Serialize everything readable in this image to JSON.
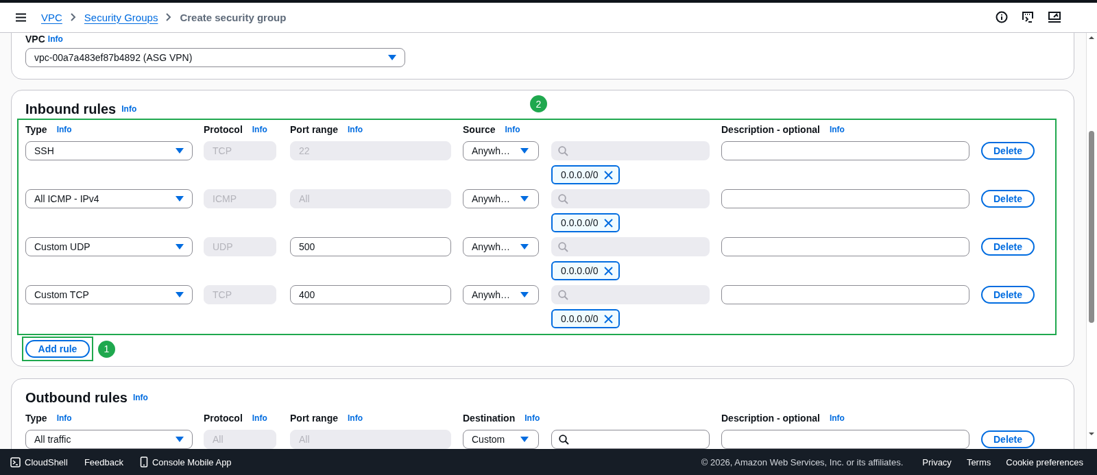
{
  "header": {
    "breadcrumbs": [
      {
        "label": "VPC",
        "link": true
      },
      {
        "label": "Security Groups",
        "link": true
      },
      {
        "label": "Create security group",
        "link": false
      }
    ]
  },
  "vpc": {
    "label": "VPC",
    "info": "Info",
    "value": "vpc-00a7a483ef87b4892 (ASG VPN)"
  },
  "inbound": {
    "title": "Inbound rules",
    "info": "Info",
    "highlighted": true,
    "badge": "2",
    "columns": [
      {
        "label": "Type",
        "info": "Info"
      },
      {
        "label": "Protocol",
        "info": "Info"
      },
      {
        "label": "Port range",
        "info": "Info"
      },
      {
        "label": "Source",
        "info": "Info"
      },
      {
        "label": "Description - optional",
        "info": "Info"
      }
    ],
    "rules": [
      {
        "type": "SSH",
        "protocol": "TCP",
        "port": "22",
        "port_disabled": true,
        "source": "Anywh…",
        "search_disabled": true,
        "chip": "0.0.0.0/0",
        "delete": "Delete"
      },
      {
        "type": "All ICMP - IPv4",
        "protocol": "ICMP",
        "port": "All",
        "port_disabled": true,
        "source": "Anywh…",
        "search_disabled": true,
        "chip": "0.0.0.0/0",
        "delete": "Delete"
      },
      {
        "type": "Custom UDP",
        "protocol": "UDP",
        "port": "500",
        "port_disabled": false,
        "source": "Anywh…",
        "search_disabled": true,
        "chip": "0.0.0.0/0",
        "delete": "Delete"
      },
      {
        "type": "Custom TCP",
        "protocol": "TCP",
        "port": "400",
        "port_disabled": false,
        "source": "Anywh…",
        "search_disabled": true,
        "chip": "0.0.0.0/0",
        "delete": "Delete"
      }
    ],
    "add_rule": {
      "label": "Add rule",
      "highlighted": true,
      "badge": "1"
    }
  },
  "outbound": {
    "title": "Outbound rules",
    "info": "Info",
    "highlighted": false,
    "columns": [
      {
        "label": "Type",
        "info": "Info"
      },
      {
        "label": "Protocol",
        "info": "Info"
      },
      {
        "label": "Port range",
        "info": "Info"
      },
      {
        "label": "Destination",
        "info": "Info"
      },
      {
        "label": "Description - optional",
        "info": "Info"
      }
    ],
    "rules": [
      {
        "type": "All traffic",
        "protocol": "All",
        "port": "All",
        "port_disabled": true,
        "source": "Custom",
        "search_disabled": false,
        "delete": "Delete"
      }
    ]
  },
  "footer": {
    "cloudshell": "CloudShell",
    "feedback": "Feedback",
    "mobile_app": "Console Mobile App",
    "copyright": "© 2026, Amazon Web Services, Inc. or its affiliates.",
    "links": [
      "Privacy",
      "Terms",
      "Cookie preferences"
    ]
  }
}
